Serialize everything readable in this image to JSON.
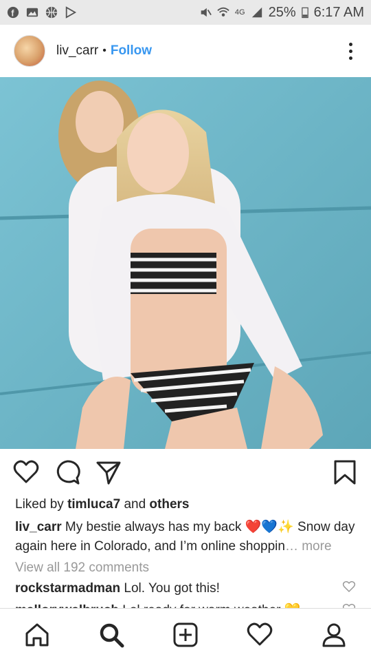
{
  "status_bar": {
    "left_icons": [
      "facebook-icon",
      "image-icon",
      "basketball-icon",
      "play-store-icon"
    ],
    "right_icons": [
      "mute-icon",
      "wifi-icon",
      "lte-icon",
      "signal-icon"
    ],
    "network": "4G",
    "battery": "25%",
    "time": "6:17 AM"
  },
  "post": {
    "username": "liv_carr",
    "separator": "•",
    "follow_label": "Follow",
    "liked_by_prefix": "Liked by",
    "liked_by_user": "timluca7",
    "liked_by_and": "and",
    "liked_by_others": "others",
    "caption_username": "liv_carr",
    "caption_text": "My bestie always has my back ❤️💙✨ Snow day again here in Colorado, and I’m online shoppin",
    "caption_more": "… more",
    "view_all_comments": "View all 192 comments",
    "comments": [
      {
        "username": "rockstarmadman",
        "text": "Lol. You got this!"
      },
      {
        "username": "mallorywalbruch",
        "text": "Lol ready for warm weather 💛"
      }
    ]
  },
  "actions": [
    "heart-icon",
    "comment-icon",
    "share-icon",
    "bookmark-icon"
  ],
  "bottom_nav": [
    "home-icon",
    "search-icon",
    "new-post-icon",
    "activity-icon",
    "profile-icon"
  ],
  "colors": {
    "link": "#3897f0",
    "text": "#262626",
    "muted": "#999999",
    "status_bar": "#e9e9e9"
  }
}
